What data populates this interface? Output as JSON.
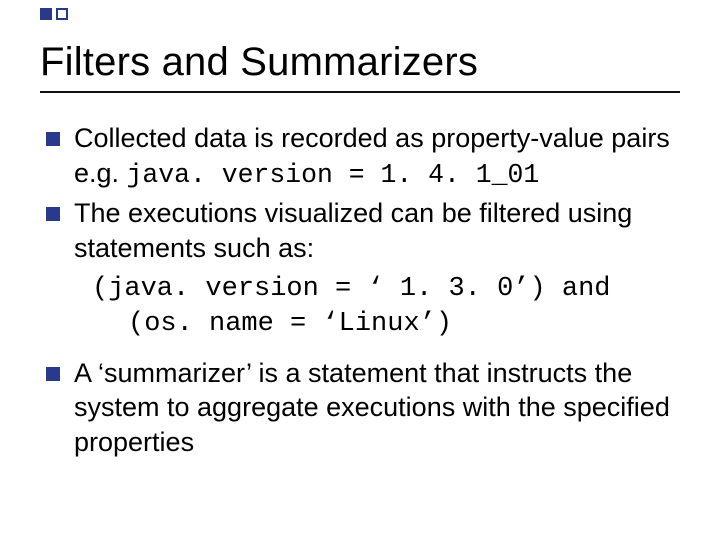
{
  "title": "Filters and Summarizers",
  "bullets": [
    {
      "pre": "Collected data is recorded as property-value pairs e.g. ",
      "code": "java. version = 1. 4. 1_01",
      "post": ""
    },
    {
      "pre": "The executions visualized can be filtered using statements such as:",
      "code": "",
      "post": ""
    }
  ],
  "code_block": {
    "line1": "(java. version = ‘ 1. 3. 0’) and",
    "line2": "(os. name = ‘Linux’)"
  },
  "bullets2": [
    {
      "pre": "A ‘summarizer’ is a statement that instructs the system to aggregate executions with the specified properties",
      "code": "",
      "post": ""
    }
  ]
}
